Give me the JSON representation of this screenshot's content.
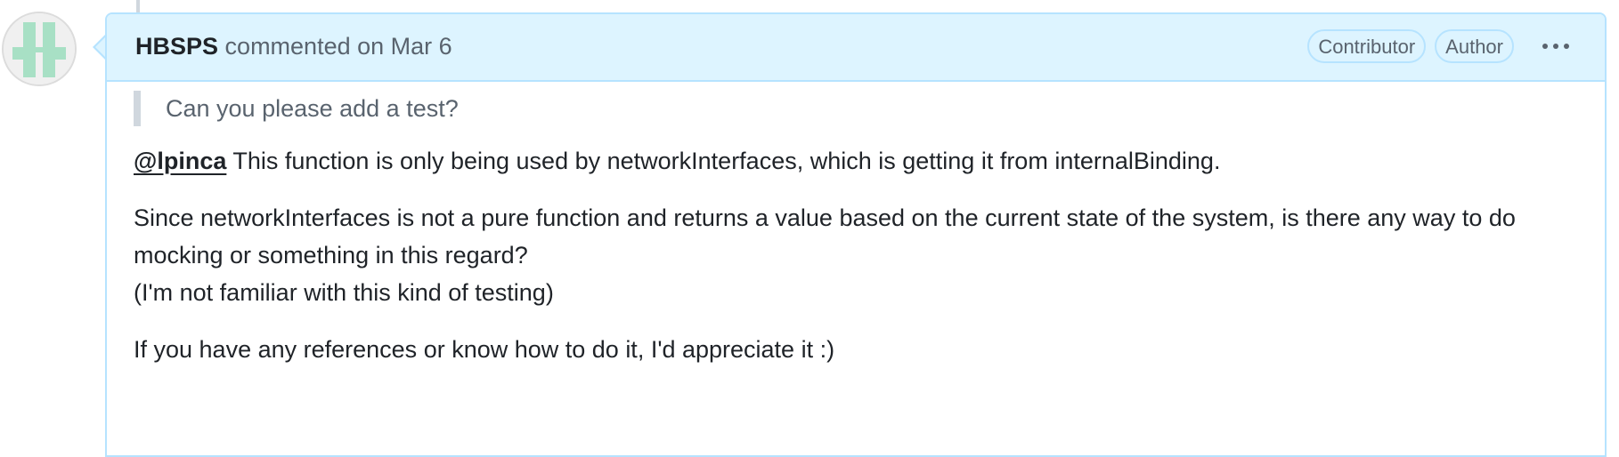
{
  "comment": {
    "author": "HBSPS",
    "action": "commented on",
    "date": "Mar 6",
    "badges": [
      "Contributor",
      "Author"
    ],
    "more_label": "More options",
    "quote": "Can you please add a test?",
    "p1": {
      "mention": "@lpinca",
      "text": " This function is only being used by networkInterfaces, which is getting it from internalBinding."
    },
    "p2": {
      "line1": "Since networkInterfaces is not a pure function and returns a value based on the current state of the system, is there any way to do mocking or something in this regard?",
      "line2": "(I'm not familiar with this kind of testing)"
    },
    "p3": "If you have any references or know how to do it, I'd appreciate it :)"
  },
  "icons": {
    "avatar": "identicon-avatar",
    "more": "kebab-horizontal-icon"
  },
  "colors": {
    "header_bg": "#ddf4ff",
    "header_border": "#b6e3ff",
    "muted_text": "#59636e",
    "text": "#1f2328",
    "avatar_green": "#a8e0c5"
  }
}
